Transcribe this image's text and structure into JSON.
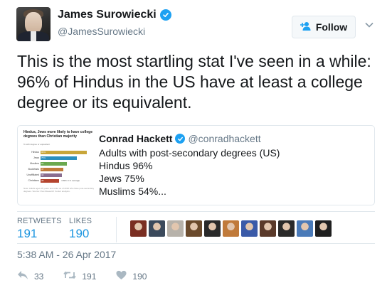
{
  "author": {
    "name": "James Surowiecki",
    "handle": "@JamesSurowiecki"
  },
  "follow_button": {
    "label": "Follow",
    "icon": "add-user-icon"
  },
  "tweet_text": "This is the most startling stat I've seen in a while: 96% of Hindus in the US have at least a college degree or its equivalent.",
  "quoted_tweet": {
    "author_name": "Conrad Hackett",
    "author_handle": "@conradhackett",
    "lines": [
      "Adults with post-secondary degrees (US)",
      "Hindus 96%",
      "Jews 75%",
      "Muslims 54%..."
    ],
    "thumbnail": {
      "title": "Hindus, Jews more likely to have college degrees than Christian majority",
      "subtitle": "% with degree or equivalent",
      "rows": [
        {
          "label": "Hindus",
          "value": "96%",
          "frac": 0.96,
          "color": "#c8a63a"
        },
        {
          "label": "Jews",
          "value": "75%",
          "frac": 0.75,
          "color": "#2a8fbf"
        },
        {
          "label": "Muslims",
          "value": "54",
          "frac": 0.54,
          "color": "#6aa84f"
        },
        {
          "label": "Buddhists",
          "value": "47",
          "frac": 0.47,
          "color": "#c07a3a"
        },
        {
          "label": "Unaffiliated",
          "value": "44",
          "frac": 0.44,
          "color": "#8a6d8f"
        },
        {
          "label": "Christians",
          "value": "38",
          "frac": 0.38,
          "color": "#b5442e"
        }
      ],
      "note": "=39% U.S. average",
      "footnote": "Note: Adults ages 25 years and older as of 2016 who have post-secondary degrees. Source: Pew Research Center analysis."
    }
  },
  "stats": {
    "retweets_label": "RETWEETS",
    "retweets_value": "191",
    "likes_label": "LIKES",
    "likes_value": "190"
  },
  "likers": [
    "#7a2e22",
    "#3b4a5c",
    "#b7b2aa",
    "#6a4a2c",
    "#2a2a2a",
    "#c07a3a",
    "#3a5aa8",
    "#5a3a2a",
    "#2a2a2a",
    "#4a7ab8",
    "#1f1f1f"
  ],
  "timestamp": "5:38 AM - 26 Apr 2017",
  "actions": {
    "reply_count": "33",
    "retweet_count": "191",
    "like_count": "190"
  },
  "colors": {
    "accent": "#1da1f2",
    "link": "#1b95e0",
    "muted": "#657786"
  }
}
